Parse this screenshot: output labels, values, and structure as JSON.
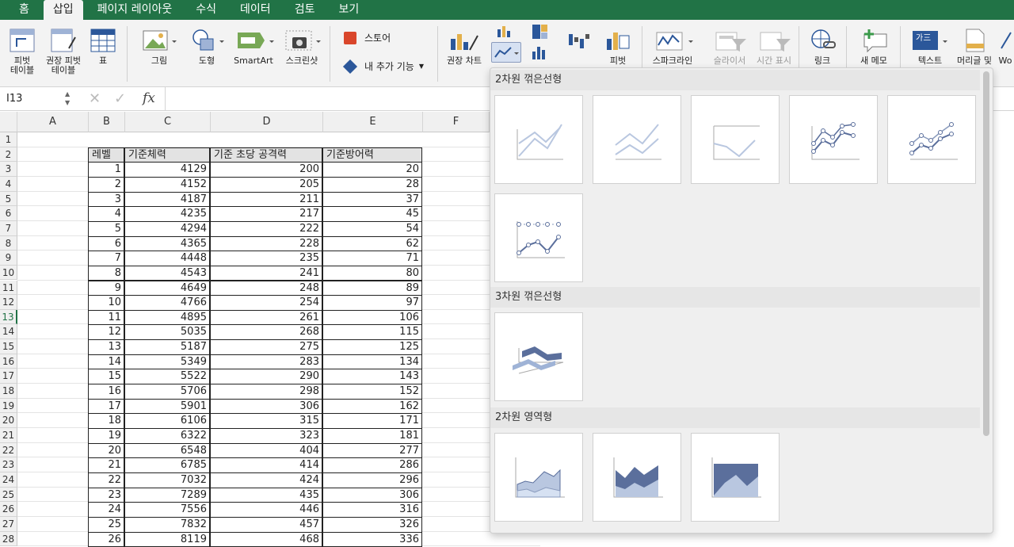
{
  "ribbon_tabs": [
    "홈",
    "삽입",
    "페이지 레이아웃",
    "수식",
    "데이터",
    "검토",
    "보기"
  ],
  "ribbon": {
    "pivot_table": "피벗\n테이블",
    "rec_pivot": "권장 피벗\n테이블",
    "table": "표",
    "picture": "그림",
    "shapes": "도형",
    "smartart": "SmartArt",
    "screenshot": "스크린샷",
    "store": "스토어",
    "my_addins": "내 추가 기능",
    "rec_charts": "권장 차트",
    "cut_1": "피벗",
    "cut_2": "스파크라인",
    "cut_3": "슬라이서",
    "cut_4": "시간 표시",
    "cut_5": "링크",
    "cut_6": "새 메모",
    "cut_7": "텍스트",
    "cut_8": "머리글 및",
    "cut_9": "Wo"
  },
  "formula_bar": {
    "name_box": "I13",
    "fx": "fx",
    "value": ""
  },
  "columns": [
    "A",
    "B",
    "C",
    "D",
    "E",
    "F"
  ],
  "rows": [
    "1",
    "2",
    "3",
    "4",
    "5",
    "6",
    "7",
    "8",
    "9",
    "10",
    "11",
    "12",
    "13",
    "14",
    "15",
    "16",
    "17",
    "18",
    "19",
    "20",
    "21",
    "22",
    "23",
    "24",
    "25",
    "26",
    "27",
    "28"
  ],
  "table": {
    "headers": [
      "레벨",
      "기준체력",
      "기준 초당 공격력",
      "기준방어력"
    ],
    "data": [
      [
        1,
        4129,
        200,
        20
      ],
      [
        2,
        4152,
        205,
        28
      ],
      [
        3,
        4187,
        211,
        37
      ],
      [
        4,
        4235,
        217,
        45
      ],
      [
        5,
        4294,
        222,
        54
      ],
      [
        6,
        4365,
        228,
        62
      ],
      [
        7,
        4448,
        235,
        71
      ],
      [
        8,
        4543,
        241,
        80
      ],
      [
        9,
        4649,
        248,
        89
      ],
      [
        10,
        4766,
        254,
        97
      ],
      [
        11,
        4895,
        261,
        106
      ],
      [
        12,
        5035,
        268,
        115
      ],
      [
        13,
        5187,
        275,
        125
      ],
      [
        14,
        5349,
        283,
        134
      ],
      [
        15,
        5522,
        290,
        143
      ],
      [
        16,
        5706,
        298,
        152
      ],
      [
        17,
        5901,
        306,
        162
      ],
      [
        18,
        6106,
        315,
        171
      ],
      [
        19,
        6322,
        323,
        181
      ],
      [
        20,
        6548,
        404,
        277
      ],
      [
        21,
        6785,
        414,
        286
      ],
      [
        22,
        7032,
        424,
        296
      ],
      [
        23,
        7289,
        435,
        306
      ],
      [
        24,
        7556,
        446,
        316
      ],
      [
        25,
        7832,
        457,
        326
      ],
      [
        26,
        8119,
        468,
        336
      ]
    ]
  },
  "chart_menu": {
    "section_2d_line": "2차원 꺾은선형",
    "section_3d_line": "3차원 꺾은선형",
    "section_2d_area": "2차원 영역형"
  },
  "colors": {
    "accent": "#217346",
    "chart_dark": "#5b6f9c",
    "chart_light": "#b9c7e0"
  }
}
